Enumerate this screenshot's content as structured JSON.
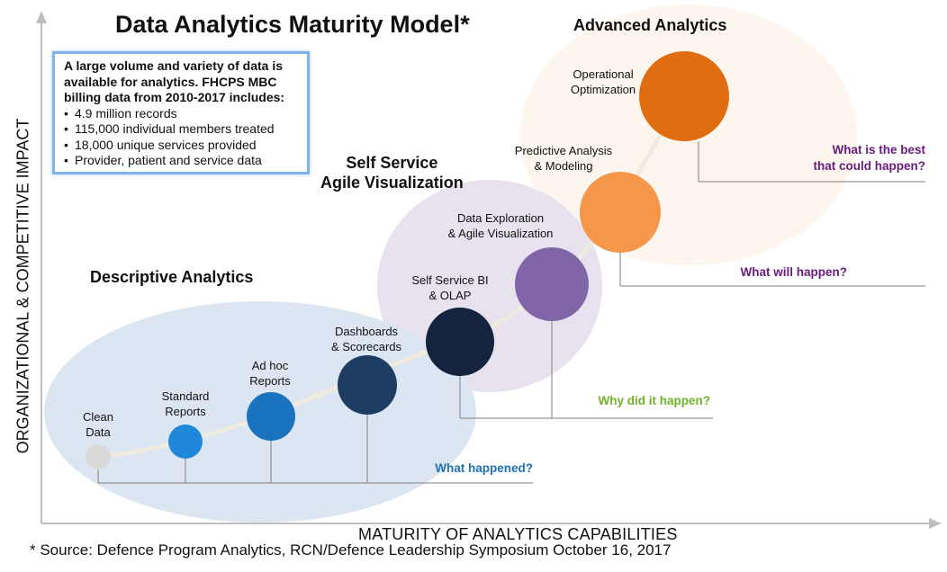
{
  "title": "Data Analytics Maturity Model*",
  "info_box": {
    "intro": "A large volume and variety of data is available for analytics. FHCPS MBC billing data from 2010-2017 includes:",
    "bullets": [
      "4.9 million records",
      "115,000 individual members treated",
      "18,000 unique services provided",
      "Provider, patient and service data"
    ]
  },
  "stages": [
    {
      "title": "Descriptive Analytics",
      "question": "What happened?",
      "question_color": "#1f6fb4"
    },
    {
      "title": "Self Service\nAgile Visualization",
      "question": "Why did it happen?",
      "question_color": "#6fb22a"
    },
    {
      "title": "Advanced Analytics",
      "question": "What will happen?",
      "question_color": "#6a1b7e"
    },
    {
      "title": "",
      "question": "What is the best\nthat could happen?",
      "question_color": "#6a1b7e"
    }
  ],
  "nodes": [
    {
      "label": "Clean\nData",
      "color": "#d9d9d9",
      "icon": "circle"
    },
    {
      "label": "Standard\nReports",
      "color": "#1f88d8",
      "icon": "circle"
    },
    {
      "label": "Ad hoc\nReports",
      "color": "#1a73bf",
      "icon": "circle"
    },
    {
      "label": "Dashboards\n& Scorecards",
      "color": "#1d3c64",
      "icon": "circle"
    },
    {
      "label": "Self Service BI\n& OLAP",
      "color": "#14233e",
      "icon": "circle"
    },
    {
      "label": "Data Exploration\n& Agile Visualization",
      "color": "#8066a8",
      "icon": "circle"
    },
    {
      "label": "Predictive Analysis\n& Modeling",
      "color": "#f5974a",
      "icon": "circle"
    },
    {
      "label": "Operational\nOptimization",
      "color": "#e06d10",
      "icon": "circle"
    }
  ],
  "axes": {
    "x_label": "MATURITY OF ANALYTICS CAPABILITIES",
    "y_label": "ORGANIZATIONAL & COMPETITIVE IMPACT"
  },
  "source_note": "* Source: Defence Program Analytics, RCN/Defence Leadership Symposium October 16, 2017",
  "colors": {
    "ellipse_blue": "#dce6f2",
    "ellipse_lavender": "#e7e2ee",
    "ellipse_peach": "#fdf6ef",
    "connector_gray": "#7f7f7f",
    "curve": "#efebdf",
    "axis": "#bfbfbf"
  }
}
